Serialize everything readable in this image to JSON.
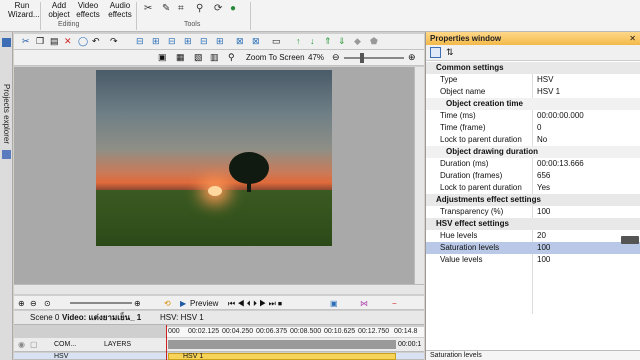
{
  "ribbon": {
    "run_label": "Run",
    "wizard_label": "Wizard...",
    "add_label": "Add",
    "add_sub": "object",
    "video_label": "Video",
    "video_sub": "effects",
    "audio_label": "Audio",
    "audio_sub": "effects",
    "group_editing": "Editing",
    "group_tools": "Tools"
  },
  "left_strip": {
    "label": "Projects explorer"
  },
  "editor": {
    "zoom_label": "Zoom To Screen",
    "zoom_value": "47%"
  },
  "player": {
    "preview_label": "Preview"
  },
  "tabs": {
    "scene": "Scene 0",
    "video": "Video: แต่งยามเย็น_ 1",
    "hsv": "HSV: HSV 1"
  },
  "timeline": {
    "ruler": [
      "000",
      "00:02.125",
      "00:04.250",
      "00:06.375",
      "00:08.500",
      "00:10.625",
      "00:12.750",
      "00:14.8"
    ],
    "row1_name": "COM...",
    "row1_layer": "LAYERS",
    "row1_time": "00:00:1",
    "row2_name": "HSV",
    "row2_clip": "HSV 1"
  },
  "properties": {
    "title": "Properties window",
    "rows": [
      {
        "kind": "sec",
        "k": "Common settings",
        "v": ""
      },
      {
        "kind": "row",
        "k": "Type",
        "v": "HSV"
      },
      {
        "kind": "row",
        "k": "Object name",
        "v": "HSV 1"
      },
      {
        "kind": "sub",
        "k": "Object creation time",
        "v": ""
      },
      {
        "kind": "row",
        "k": "Time (ms)",
        "v": "00:00:00.000"
      },
      {
        "kind": "row",
        "k": "Time (frame)",
        "v": "0"
      },
      {
        "kind": "row",
        "k": "Lock to parent duration",
        "v": "No"
      },
      {
        "kind": "sub",
        "k": "Object drawing duration",
        "v": ""
      },
      {
        "kind": "row",
        "k": "Duration (ms)",
        "v": "00:00:13.666"
      },
      {
        "kind": "row",
        "k": "Duration (frames)",
        "v": "656"
      },
      {
        "kind": "row",
        "k": "Lock to parent duration",
        "v": "Yes"
      },
      {
        "kind": "sec",
        "k": "Adjustments effect settings",
        "v": ""
      },
      {
        "kind": "row",
        "k": "Transparency (%)",
        "v": "100"
      },
      {
        "kind": "sec",
        "k": "HSV effect settings",
        "v": ""
      },
      {
        "kind": "row",
        "k": "Hue levels",
        "v": "20"
      },
      {
        "kind": "row",
        "k": "Saturation levels",
        "v": "100"
      },
      {
        "kind": "row",
        "k": "Value levels",
        "v": "100"
      }
    ],
    "footer": "Saturation levels"
  },
  "colors": {
    "accent": "#f3b94a",
    "clip": "#f7d35a",
    "selected_row": "#b9c8e6"
  }
}
